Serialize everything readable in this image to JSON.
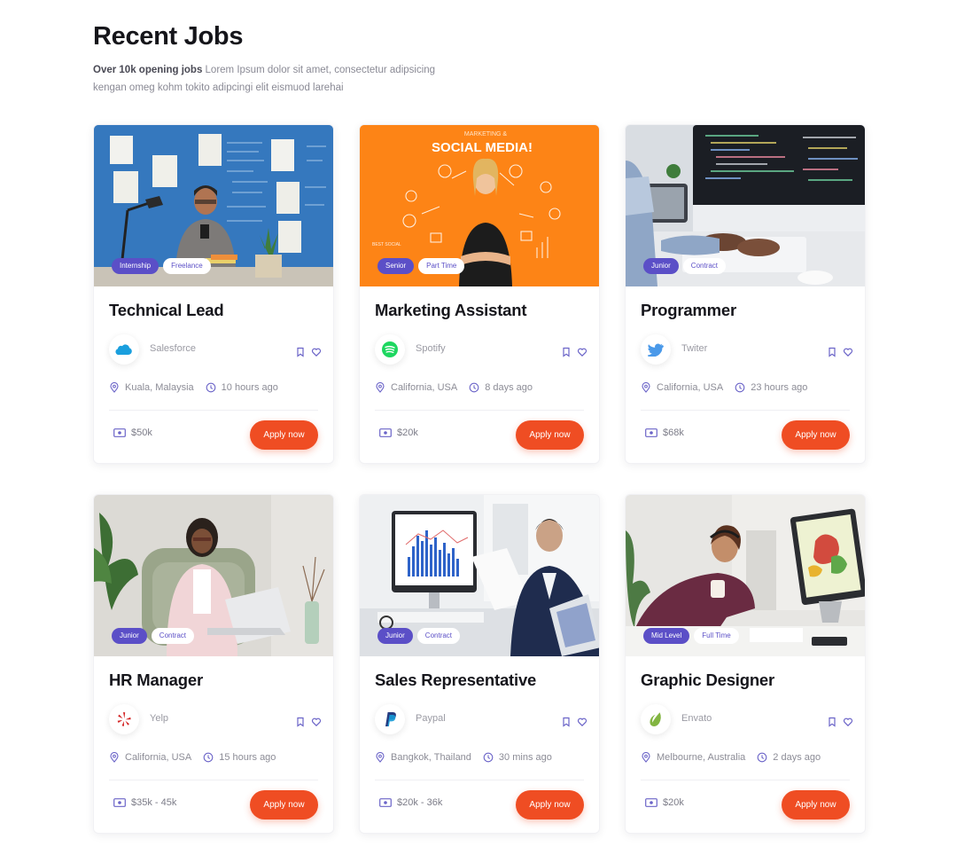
{
  "header": {
    "title": "Recent Jobs",
    "subtitle_bold": "Over 10k opening jobs",
    "subtitle_line1": " Lorem Ipsum dolor sit amet, consectetur adipsicing",
    "subtitle_line2": "kengan omeg kohm tokito adipcingi elit eismuod larehai"
  },
  "colors": {
    "accent": "#ef4d23",
    "tag_primary": "#5b4fc7",
    "card_border": "#f1f1f4"
  },
  "jobs": [
    {
      "title": "Technical Lead",
      "company": "Salesforce",
      "location": "Kuala, Malaysia",
      "posted": "10 hours ago",
      "salary": "$50k",
      "tags": [
        "Internship",
        "Freelance"
      ],
      "apply_label": "Apply now",
      "company_icon": "salesforce-logo-icon"
    },
    {
      "title": "Marketing Assistant",
      "company": "Spotify",
      "location": "California, USA",
      "posted": "8 days ago",
      "salary": "$20k",
      "tags": [
        "Senior",
        "Part Time"
      ],
      "apply_label": "Apply now",
      "company_icon": "spotify-logo-icon"
    },
    {
      "title": "Programmer",
      "company": "Twiter",
      "location": "California, USA",
      "posted": "23 hours ago",
      "salary": "$68k",
      "tags": [
        "Junior",
        "Contract"
      ],
      "apply_label": "Apply now",
      "company_icon": "twitter-logo-icon"
    },
    {
      "title": "HR Manager",
      "company": "Yelp",
      "location": "California, USA",
      "posted": "15 hours ago",
      "salary": "$35k - 45k",
      "tags": [
        "Junior",
        "Contract"
      ],
      "apply_label": "Apply now",
      "company_icon": "yelp-logo-icon"
    },
    {
      "title": "Sales Representative",
      "company": "Paypal",
      "location": "Bangkok, Thailand",
      "posted": "30 mins ago",
      "salary": "$20k - 36k",
      "tags": [
        "Junior",
        "Contract"
      ],
      "apply_label": "Apply now",
      "company_icon": "paypal-logo-icon"
    },
    {
      "title": "Graphic Designer",
      "company": "Envato",
      "location": "Melbourne, Australia",
      "posted": "2 days ago",
      "salary": "$20k",
      "tags": [
        "Mid Level",
        "Full Time"
      ],
      "apply_label": "Apply now",
      "company_icon": "envato-logo-icon"
    }
  ],
  "scene_text": {
    "marketing_top": "MARKETING &",
    "marketing_main": "SOCIAL MEDIA!"
  }
}
